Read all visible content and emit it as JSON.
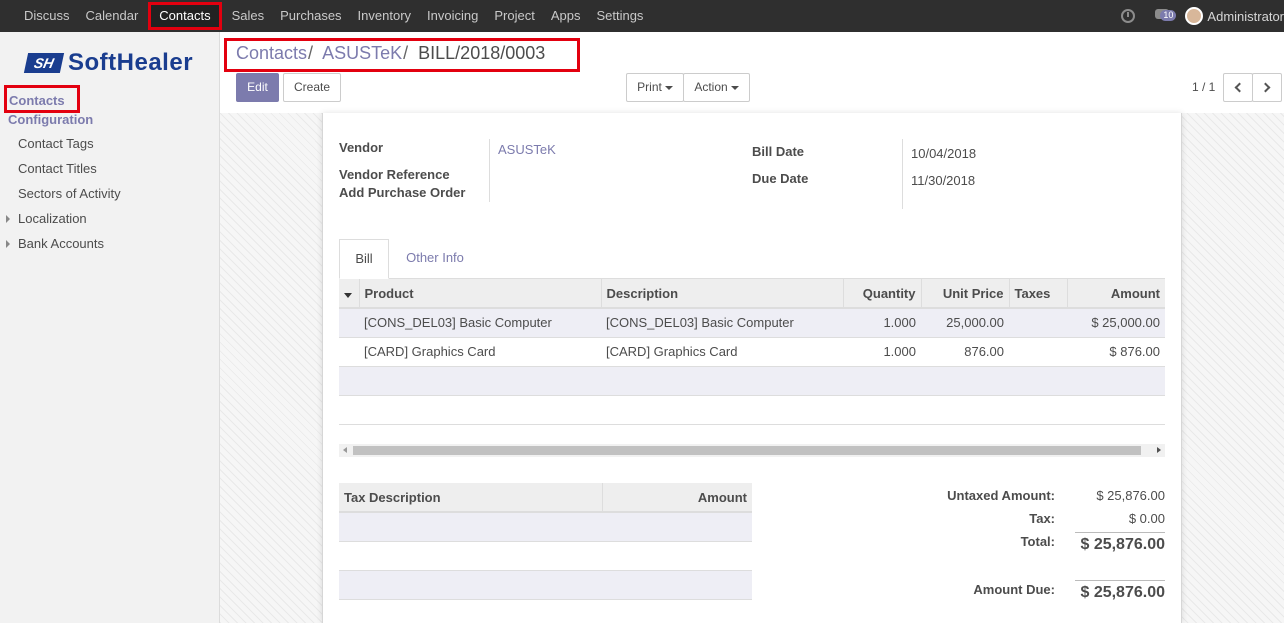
{
  "topbar": {
    "menu": [
      "Discuss",
      "Calendar",
      "Contacts",
      "Sales",
      "Purchases",
      "Inventory",
      "Invoicing",
      "Project",
      "Apps",
      "Settings"
    ],
    "active_index": 2,
    "chat_badge": "10",
    "user": "Administrator"
  },
  "sidebar": {
    "logo_mark": "SH",
    "logo_text": "SoftHealer",
    "contacts": "Contacts",
    "configuration": "Configuration",
    "items": [
      "Contact Tags",
      "Contact Titles",
      "Sectors of Activity"
    ],
    "groups": [
      "Localization",
      "Bank Accounts"
    ]
  },
  "breadcrumb": {
    "parent": "Contacts",
    "middle": "ASUSTeK",
    "current": "BILL/2018/0003",
    "sep": "/"
  },
  "buttons": {
    "edit": "Edit",
    "create": "Create",
    "print": "Print",
    "action": "Action"
  },
  "pager": {
    "value": "1 / 1"
  },
  "form": {
    "vendor_label": "Vendor",
    "vendor_value": "ASUSTeK",
    "vendor_ref_label": "Vendor Reference",
    "add_po_label": "Add Purchase Order",
    "bill_date_label": "Bill Date",
    "bill_date": "10/04/2018",
    "due_date_label": "Due Date",
    "due_date": "11/30/2018"
  },
  "tabs": [
    "Bill",
    "Other Info"
  ],
  "lines": {
    "headers": [
      "Product",
      "Description",
      "Quantity",
      "Unit Price",
      "Taxes",
      "Amount"
    ],
    "rows": [
      [
        "[CONS_DEL03] Basic Computer",
        "[CONS_DEL03] Basic Computer",
        "1.000",
        "25,000.00",
        "",
        "$ 25,000.00"
      ],
      [
        "[CARD] Graphics Card",
        "[CARD] Graphics Card",
        "1.000",
        "876.00",
        "",
        "$ 876.00"
      ]
    ]
  },
  "tax_table": {
    "headers": [
      "Tax Description",
      "Amount"
    ]
  },
  "totals": {
    "untaxed_label": "Untaxed Amount:",
    "untaxed": "$ 25,876.00",
    "tax_label": "Tax:",
    "tax": "$ 0.00",
    "total_label": "Total:",
    "total": "$ 25,876.00",
    "due_label": "Amount Due:",
    "due": "$ 25,876.00"
  }
}
